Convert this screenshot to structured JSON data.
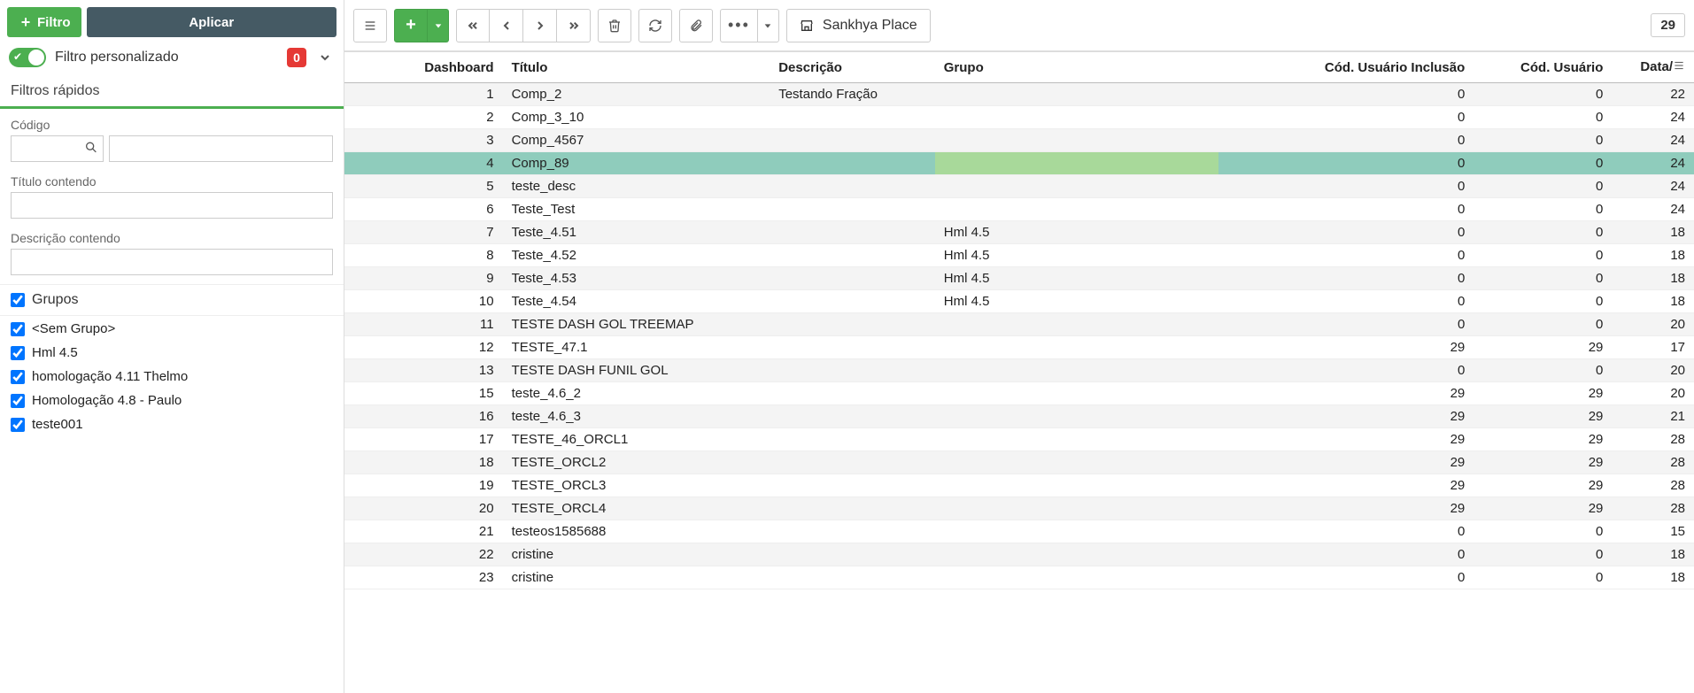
{
  "sidebar": {
    "filtro_button": "Filtro",
    "aplicar_button": "Aplicar",
    "toggle_label": "Filtro personalizado",
    "badge": "0",
    "quick_filters_header": "Filtros rápidos",
    "codigo_label": "Código",
    "titulo_label": "Título contendo",
    "descricao_label": "Descrição contendo",
    "grupos_label": "Grupos",
    "groups": [
      {
        "label": "<Sem Grupo>",
        "checked": true
      },
      {
        "label": "Hml 4.5",
        "checked": true
      },
      {
        "label": "homologação 4.11 Thelmo",
        "checked": true
      },
      {
        "label": "Homologação 4.8 - Paulo",
        "checked": true
      },
      {
        "label": "teste001",
        "checked": true
      }
    ]
  },
  "toolbar": {
    "sankhya_label": "Sankhya Place",
    "record_count": "29"
  },
  "grid": {
    "columns": [
      {
        "key": "dashboard",
        "label": "Dashboard",
        "cls": "col-dash num"
      },
      {
        "key": "titulo",
        "label": "Título",
        "cls": "col-titulo"
      },
      {
        "key": "descricao",
        "label": "Descrição",
        "cls": "col-desc"
      },
      {
        "key": "grupo",
        "label": "Grupo",
        "cls": "col-grupo"
      },
      {
        "key": "cod_usuario_inclusao",
        "label": "Cód. Usuário Inclusão",
        "cls": "col-uinc num"
      },
      {
        "key": "cod_usuario",
        "label": "Cód. Usuário",
        "cls": "col-usu num"
      },
      {
        "key": "data",
        "label": "Data/",
        "cls": "col-data num"
      }
    ],
    "selected_row": 3,
    "rows": [
      {
        "dashboard": "1",
        "titulo": "Comp_2",
        "descricao": "Testando Fração",
        "grupo": "",
        "cod_usuario_inclusao": "0",
        "cod_usuario": "0",
        "data": "22"
      },
      {
        "dashboard": "2",
        "titulo": "Comp_3_10",
        "descricao": "",
        "grupo": "",
        "cod_usuario_inclusao": "0",
        "cod_usuario": "0",
        "data": "24"
      },
      {
        "dashboard": "3",
        "titulo": "Comp_4567",
        "descricao": "",
        "grupo": "",
        "cod_usuario_inclusao": "0",
        "cod_usuario": "0",
        "data": "24"
      },
      {
        "dashboard": "4",
        "titulo": "Comp_89",
        "descricao": "",
        "grupo": "",
        "cod_usuario_inclusao": "0",
        "cod_usuario": "0",
        "data": "24"
      },
      {
        "dashboard": "5",
        "titulo": "teste_desc",
        "descricao": "",
        "grupo": "",
        "cod_usuario_inclusao": "0",
        "cod_usuario": "0",
        "data": "24"
      },
      {
        "dashboard": "6",
        "titulo": "Teste_Test",
        "descricao": "",
        "grupo": "",
        "cod_usuario_inclusao": "0",
        "cod_usuario": "0",
        "data": "24"
      },
      {
        "dashboard": "7",
        "titulo": "Teste_4.51",
        "descricao": "",
        "grupo": "Hml 4.5",
        "cod_usuario_inclusao": "0",
        "cod_usuario": "0",
        "data": "18"
      },
      {
        "dashboard": "8",
        "titulo": "Teste_4.52",
        "descricao": "",
        "grupo": "Hml 4.5",
        "cod_usuario_inclusao": "0",
        "cod_usuario": "0",
        "data": "18"
      },
      {
        "dashboard": "9",
        "titulo": "Teste_4.53",
        "descricao": "",
        "grupo": "Hml 4.5",
        "cod_usuario_inclusao": "0",
        "cod_usuario": "0",
        "data": "18"
      },
      {
        "dashboard": "10",
        "titulo": "Teste_4.54",
        "descricao": "",
        "grupo": "Hml 4.5",
        "cod_usuario_inclusao": "0",
        "cod_usuario": "0",
        "data": "18"
      },
      {
        "dashboard": "11",
        "titulo": "TESTE DASH GOL TREEMAP",
        "descricao": "",
        "grupo": "",
        "cod_usuario_inclusao": "0",
        "cod_usuario": "0",
        "data": "20"
      },
      {
        "dashboard": "12",
        "titulo": "TESTE_47.1",
        "descricao": "",
        "grupo": "",
        "cod_usuario_inclusao": "29",
        "cod_usuario": "29",
        "data": "17"
      },
      {
        "dashboard": "13",
        "titulo": "TESTE DASH FUNIL GOL",
        "descricao": "",
        "grupo": "",
        "cod_usuario_inclusao": "0",
        "cod_usuario": "0",
        "data": "20"
      },
      {
        "dashboard": "15",
        "titulo": "teste_4.6_2",
        "descricao": "",
        "grupo": "",
        "cod_usuario_inclusao": "29",
        "cod_usuario": "29",
        "data": "20"
      },
      {
        "dashboard": "16",
        "titulo": "teste_4.6_3",
        "descricao": "",
        "grupo": "",
        "cod_usuario_inclusao": "29",
        "cod_usuario": "29",
        "data": "21"
      },
      {
        "dashboard": "17",
        "titulo": "TESTE_46_ORCL1",
        "descricao": "",
        "grupo": "",
        "cod_usuario_inclusao": "29",
        "cod_usuario": "29",
        "data": "28"
      },
      {
        "dashboard": "18",
        "titulo": "TESTE_ORCL2",
        "descricao": "",
        "grupo": "",
        "cod_usuario_inclusao": "29",
        "cod_usuario": "29",
        "data": "28"
      },
      {
        "dashboard": "19",
        "titulo": "TESTE_ORCL3",
        "descricao": "",
        "grupo": "",
        "cod_usuario_inclusao": "29",
        "cod_usuario": "29",
        "data": "28"
      },
      {
        "dashboard": "20",
        "titulo": "TESTE_ORCL4",
        "descricao": "",
        "grupo": "",
        "cod_usuario_inclusao": "29",
        "cod_usuario": "29",
        "data": "28"
      },
      {
        "dashboard": "21",
        "titulo": "testeos1585688",
        "descricao": "",
        "grupo": "",
        "cod_usuario_inclusao": "0",
        "cod_usuario": "0",
        "data": "15"
      },
      {
        "dashboard": "22",
        "titulo": "cristine",
        "descricao": "",
        "grupo": "",
        "cod_usuario_inclusao": "0",
        "cod_usuario": "0",
        "data": "18"
      },
      {
        "dashboard": "23",
        "titulo": "cristine",
        "descricao": "",
        "grupo": "",
        "cod_usuario_inclusao": "0",
        "cod_usuario": "0",
        "data": "18"
      }
    ]
  }
}
